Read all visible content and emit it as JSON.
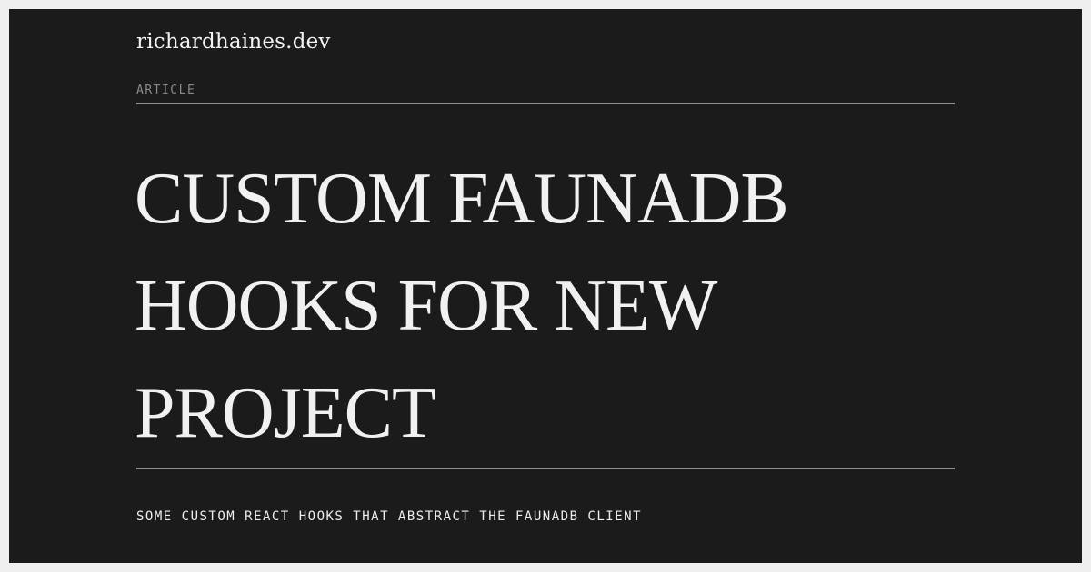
{
  "site": {
    "name": "richardhaines.dev"
  },
  "article": {
    "kicker": "ARTICLE",
    "title_lines": [
      "CUSTOM FAUNADB",
      "HOOKS FOR NEW",
      "PROJECT"
    ],
    "subtitle": "SOME CUSTOM REACT HOOKS THAT ABSTRACT THE FAUNADB CLIENT"
  },
  "colors": {
    "page_background": "#efefef",
    "card_background": "#1b1b1b",
    "text_primary": "#f1f1f1",
    "text_muted": "#8a8a8a",
    "rule": "#8f8f8f"
  }
}
